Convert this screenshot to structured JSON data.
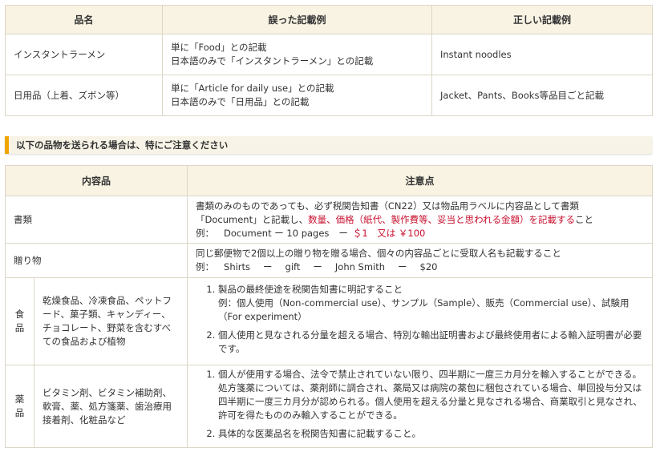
{
  "table1": {
    "headers": [
      "品名",
      "誤った記載例",
      "正しい記載例"
    ],
    "rows": [
      {
        "item": "インスタントラーメン",
        "wrong_1": "単に「Food」との記載",
        "wrong_2": "日本語のみで「インスタントラーメン」との記載",
        "correct": "Instant noodles"
      },
      {
        "item": "日用品（上着、ズボン等）",
        "wrong_1": "単に「Article for daily use」との記載",
        "wrong_2": "日本語のみで「日用品」との記載",
        "correct": "Jacket、Pants、Books等品目ごと記載"
      }
    ]
  },
  "notice": "以下の品物を送られる場合は、特にご注意ください",
  "table2": {
    "headers": [
      "内容品",
      "注意点"
    ],
    "documents": {
      "label": "書類",
      "line1": "書類のみのものであっても、必ず税関告知書（CN22）又は物品用ラベルに内容品として書類",
      "line2_a": "「Document」と記載し、",
      "line2_red": "数量、価格（紙代、製作費等、妥当と思われる金額）を記載する",
      "line2_b": "こと",
      "ex_prefix": "例：",
      "ex_text": "Document ー 10 pages",
      "ex_dash": "ー",
      "ex_red": "＄1　又は ￥100"
    },
    "gift": {
      "label": "贈り物",
      "line1": "同じ郵便物で2個以上の贈り物を贈る場合、個々の内容品ごとに受取人名も記載すること",
      "ex_prefix": "例：",
      "ex_parts": [
        "Shirts",
        "ー",
        "gift",
        "ー",
        "John Smith",
        "ー",
        "$20"
      ]
    },
    "food": {
      "category": "食品",
      "items": "乾燥食品、冷凍食品、ペットフード、菓子類、キャンディー、チョコレート、野菜を含むすべての食品および植物",
      "note1_a": "製品の最終使途を税関告知書に明記すること",
      "note1_b": "例：個人使用（Non-commercial use）、サンプル（Sample）、販売（Commercial use）、試験用（For experiment）",
      "note2": "個人使用と見なされる分量を超える場合、特別な輸出証明書および最終使用者による輸入証明書が必要です。"
    },
    "medicine": {
      "category": "薬品",
      "items": "ビタミン剤、ビタミン補助剤、軟膏、薬、処方箋薬、歯治療用接着剤、化粧品など",
      "note1": "個人が使用する場合、法令で禁止されていない限り、四半期に一度三カ月分を輸入することができる。処方箋薬については、薬剤師に調合され、薬局又は病院の薬包に梱包されている場合、単回投与分又は四半期に一度三カ月分が認められる。個人使用を超える分量と見なされる場合、商業取引と見なされ、許可を得たもののみ輸入することができる。",
      "note2": "具体的な医薬品名を税関告知書に記載すること。"
    }
  },
  "colors": {
    "accent": "#f0a500",
    "header_bg": "#f8f3e3",
    "red_text": "#c8102e",
    "border": "#dcd6c6"
  }
}
